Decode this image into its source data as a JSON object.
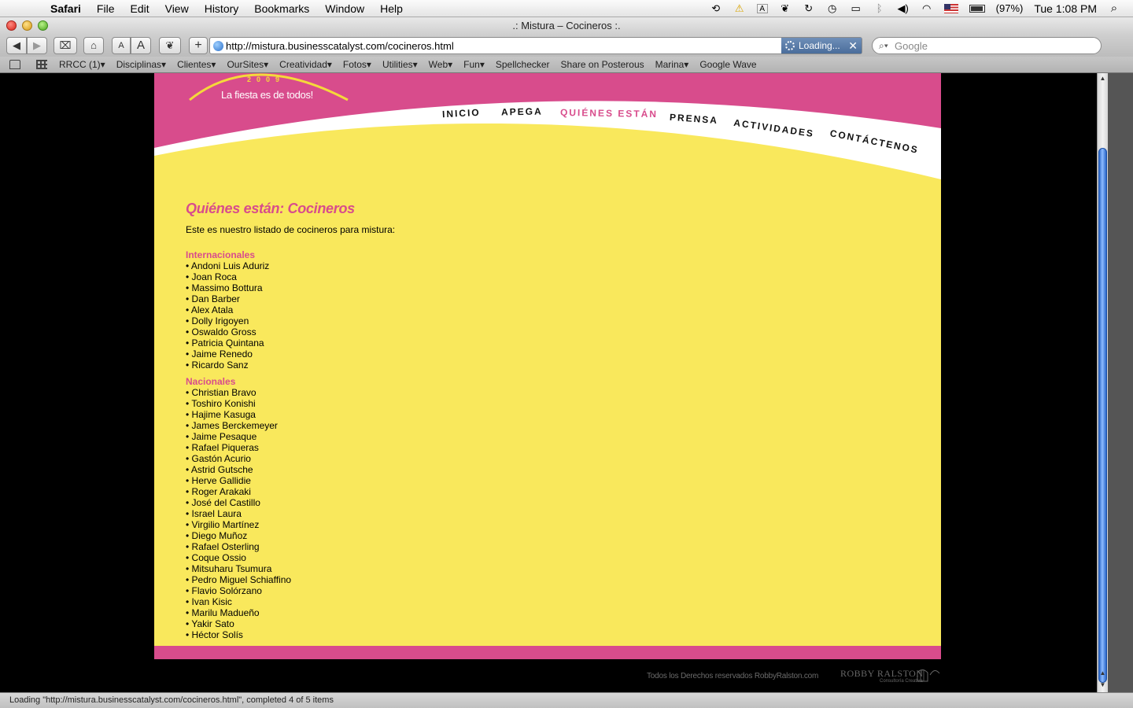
{
  "menubar": {
    "app": "Safari",
    "items": [
      "File",
      "Edit",
      "View",
      "History",
      "Bookmarks",
      "Window",
      "Help"
    ],
    "battery": "(97%)",
    "clock": "Tue 1:08 PM"
  },
  "window": {
    "title": ".: Mistura – Cocineros :."
  },
  "toolbar": {
    "text_smaller": "A",
    "text_bigger": "A",
    "add": "+",
    "url": "http://mistura.businesscatalyst.com/cocineros.html",
    "loading": "Loading...",
    "search_placeholder": "Google"
  },
  "bookmarks": [
    "RRCC (1)▾",
    "Disciplinas▾",
    "Clientes▾",
    "OurSites▾",
    "Creatividad▾",
    "Fotos▾",
    "Utilities▾",
    "Web▾",
    "Fun▾",
    "Spellchecker",
    "Share on Posterous",
    "Marina▾",
    "Google Wave"
  ],
  "site": {
    "year": "2009",
    "tagline": "La fiesta es de todos!",
    "nav": [
      "INICIO",
      "APEGA",
      "QUIÉNES ESTÁN",
      "PRENSA",
      "ACTIVIDADES",
      "CONTÁCTENOS"
    ],
    "heading": "Quiénes están: Cocineros",
    "intro": "Este es nuestro listado de cocineros para mistura:",
    "internacionales": {
      "title": "Internacionales",
      "chefs": [
        "Andoni Luis Aduriz",
        "Joan Roca",
        "Massimo Bottura",
        "Dan Barber",
        "Alex Atala",
        "Dolly Irigoyen",
        "Oswaldo Gross",
        "Patricia Quintana",
        "Jaime Renedo",
        "Ricardo Sanz"
      ]
    },
    "nacionales": {
      "title": "Nacionales",
      "chefs": [
        "Christian Bravo",
        "Toshiro Konishi",
        "Hajime Kasuga",
        "James Berckemeyer",
        "Jaime Pesaque",
        "Rafael Piqueras",
        "Gastón Acurio",
        "Astrid Gutsche",
        "Herve Gallidie",
        "Roger Arakaki",
        "José del Castillo",
        "Israel Laura",
        "Virgilio Martínez",
        "Diego Muñoz",
        "Rafael Osterling",
        "Coque Ossio",
        "Mitsuharu Tsumura",
        "Pedro Miguel Schiaffino",
        "Flavio Solórzano",
        "Ivan Kisic",
        "Marilu Madueño",
        "Yakir Sato",
        "Héctor Solís"
      ]
    },
    "copyright": "Todos los Derechos reservados RobbyRalston.com",
    "credit_logo": "ROBBY RALSTON",
    "credit_sub": "Consultoría Creativa"
  },
  "status": "Loading \"http://mistura.businesscatalyst.com/cocineros.html\", completed 4 of 5 items",
  "colors": {
    "brand_pink": "#d84c8c",
    "brand_yellow": "#f9e85c",
    "accent_blue": "#2a66c8"
  }
}
